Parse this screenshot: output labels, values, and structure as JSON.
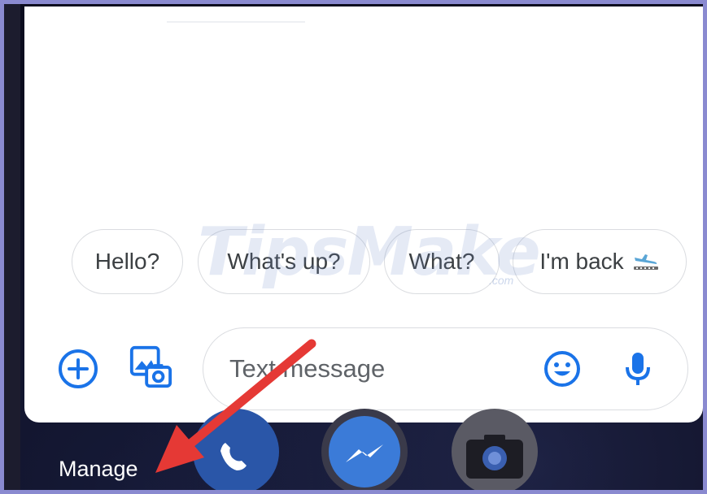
{
  "suggestions": [
    {
      "label": "Hello?"
    },
    {
      "label": "What's up?"
    },
    {
      "label": "What?"
    },
    {
      "label": "I'm back"
    }
  ],
  "compose": {
    "placeholder": "Text message"
  },
  "icons": {
    "add": "plus-circle-icon",
    "gallery": "image-camera-icon",
    "emoji": "smiley-icon",
    "mic": "microphone-icon",
    "suggestion_emoji": "airplane-landing-icon",
    "dock": [
      "phone-icon",
      "messenger-icon",
      "camera-icon"
    ]
  },
  "dock": {
    "manage_label": "Manage"
  },
  "watermark": {
    "text": "TipsMake",
    "suffix": ".com"
  },
  "colors": {
    "accent": "#1a73e8",
    "annotation_arrow": "#e53935",
    "frame_border": "#8a8ad0"
  }
}
